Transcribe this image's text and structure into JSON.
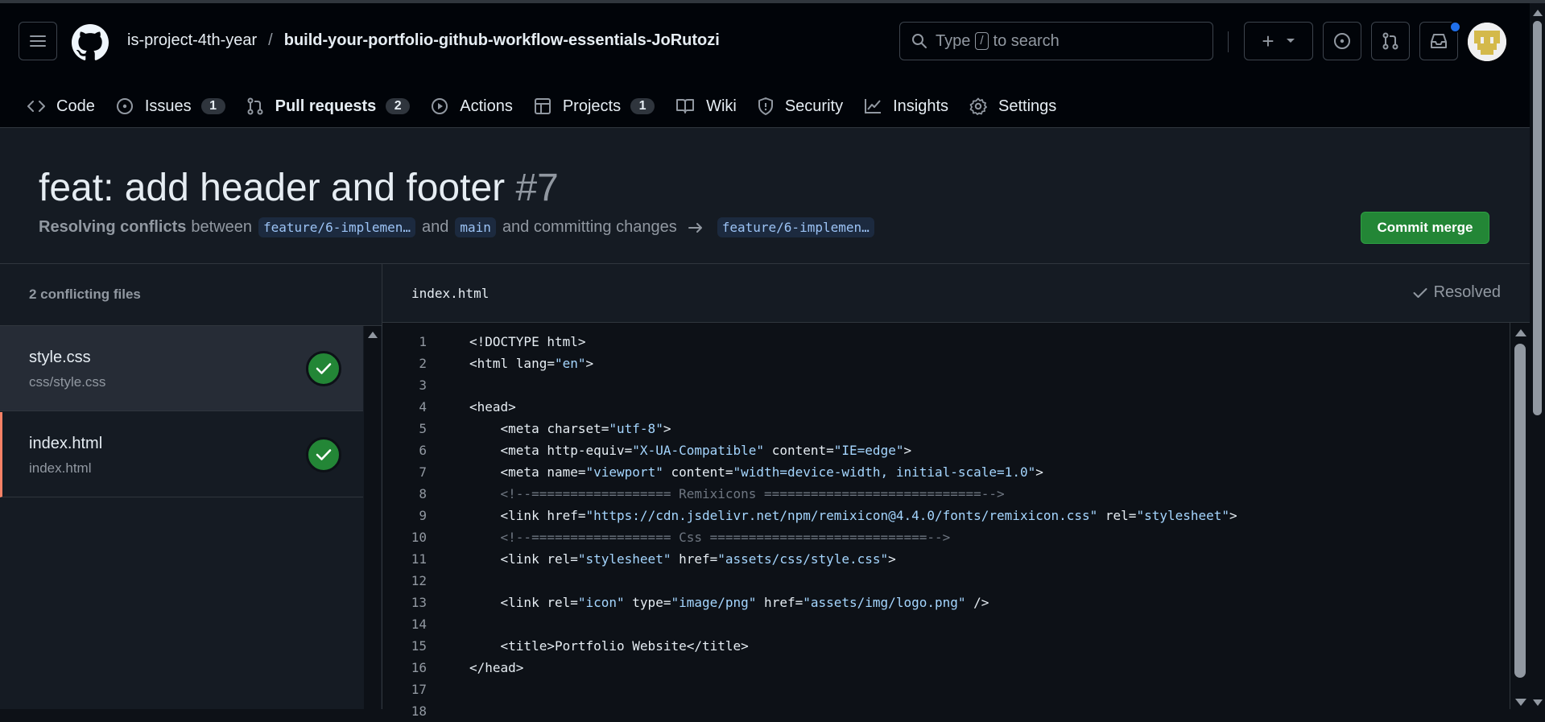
{
  "header": {
    "owner": "is-project-4th-year",
    "separator": "/",
    "repo": "build-your-portfolio-github-workflow-essentials-JoRutozi",
    "search": {
      "prefix": "Type",
      "key": "/",
      "suffix": "to search"
    },
    "plus_label": "+"
  },
  "tabs": [
    {
      "label": "Code",
      "icon": "code-icon"
    },
    {
      "label": "Issues",
      "icon": "issue-icon",
      "count": "1"
    },
    {
      "label": "Pull requests",
      "icon": "pull-request-icon",
      "count": "2",
      "active": true
    },
    {
      "label": "Actions",
      "icon": "play-icon"
    },
    {
      "label": "Projects",
      "icon": "table-icon",
      "count": "1"
    },
    {
      "label": "Wiki",
      "icon": "book-icon"
    },
    {
      "label": "Security",
      "icon": "shield-icon"
    },
    {
      "label": "Insights",
      "icon": "graph-icon"
    },
    {
      "label": "Settings",
      "icon": "gear-icon"
    }
  ],
  "pr": {
    "title": "feat: add header and footer",
    "number": "#7",
    "resolving_label": "Resolving conflicts",
    "between": "between",
    "head_branch": "feature/6-implemen…",
    "and": "and",
    "base_branch": "main",
    "committing": "and committing changes",
    "target_branch": "feature/6-implemen…",
    "commit_button": "Commit merge"
  },
  "sidebar": {
    "heading": "2 conflicting files",
    "files": [
      {
        "name": "style.css",
        "path": "css/style.css",
        "status": "resolved"
      },
      {
        "name": "index.html",
        "path": "index.html",
        "status": "resolved"
      }
    ]
  },
  "editor": {
    "filename": "index.html",
    "status": "Resolved",
    "lines": [
      {
        "n": "1",
        "tokens": [
          [
            "t",
            "<!DOCTYPE html>"
          ]
        ]
      },
      {
        "n": "2",
        "tokens": [
          [
            "t",
            "<html lang="
          ],
          [
            "s",
            "\"en\""
          ],
          [
            "t",
            ">"
          ]
        ]
      },
      {
        "n": "3",
        "tokens": []
      },
      {
        "n": "4",
        "tokens": [
          [
            "t",
            "<head>"
          ]
        ]
      },
      {
        "n": "5",
        "tokens": [
          [
            "t",
            "    <meta charset="
          ],
          [
            "s",
            "\"utf-8\""
          ],
          [
            "t",
            ">"
          ]
        ]
      },
      {
        "n": "6",
        "tokens": [
          [
            "t",
            "    <meta http-equiv="
          ],
          [
            "s",
            "\"X-UA-Compatible\""
          ],
          [
            "t",
            " content="
          ],
          [
            "s",
            "\"IE=edge\""
          ],
          [
            "t",
            ">"
          ]
        ]
      },
      {
        "n": "7",
        "tokens": [
          [
            "t",
            "    <meta name="
          ],
          [
            "s",
            "\"viewport\""
          ],
          [
            "t",
            " content="
          ],
          [
            "s",
            "\"width=device-width, initial-scale=1.0\""
          ],
          [
            "t",
            ">"
          ]
        ]
      },
      {
        "n": "8",
        "tokens": [
          [
            "c",
            "    <!--================== Remixicons ============================-->"
          ]
        ]
      },
      {
        "n": "9",
        "tokens": [
          [
            "t",
            "    <link href="
          ],
          [
            "s",
            "\"https://cdn.jsdelivr.net/npm/remixicon@4.4.0/fonts/remixicon.css\""
          ],
          [
            "t",
            " rel="
          ],
          [
            "s",
            "\"stylesheet\""
          ],
          [
            "t",
            ">"
          ]
        ]
      },
      {
        "n": "10",
        "tokens": [
          [
            "c",
            "    <!--================== Css ============================-->"
          ]
        ]
      },
      {
        "n": "11",
        "tokens": [
          [
            "t",
            "    <link rel="
          ],
          [
            "s",
            "\"stylesheet\""
          ],
          [
            "t",
            " href="
          ],
          [
            "s",
            "\"assets/css/style.css\""
          ],
          [
            "t",
            ">"
          ]
        ]
      },
      {
        "n": "12",
        "tokens": []
      },
      {
        "n": "13",
        "tokens": [
          [
            "t",
            "    <link rel="
          ],
          [
            "s",
            "\"icon\""
          ],
          [
            "t",
            " type="
          ],
          [
            "s",
            "\"image/png\""
          ],
          [
            "t",
            " href="
          ],
          [
            "s",
            "\"assets/img/logo.png\""
          ],
          [
            "t",
            " />"
          ]
        ]
      },
      {
        "n": "14",
        "tokens": []
      },
      {
        "n": "15",
        "tokens": [
          [
            "t",
            "    <title>Portfolio Website</title>"
          ]
        ]
      },
      {
        "n": "16",
        "tokens": [
          [
            "t",
            "</head>"
          ]
        ]
      },
      {
        "n": "17",
        "tokens": []
      },
      {
        "n": "18",
        "tokens": []
      }
    ]
  },
  "colors": {
    "page_bg": "#0d1117",
    "header_bg": "#010409",
    "accent_underline": "#f78166",
    "primary_button": "#238636",
    "code_string": "#a5d6ff",
    "code_comment": "#6e7681",
    "notification": "#1f6feb"
  }
}
